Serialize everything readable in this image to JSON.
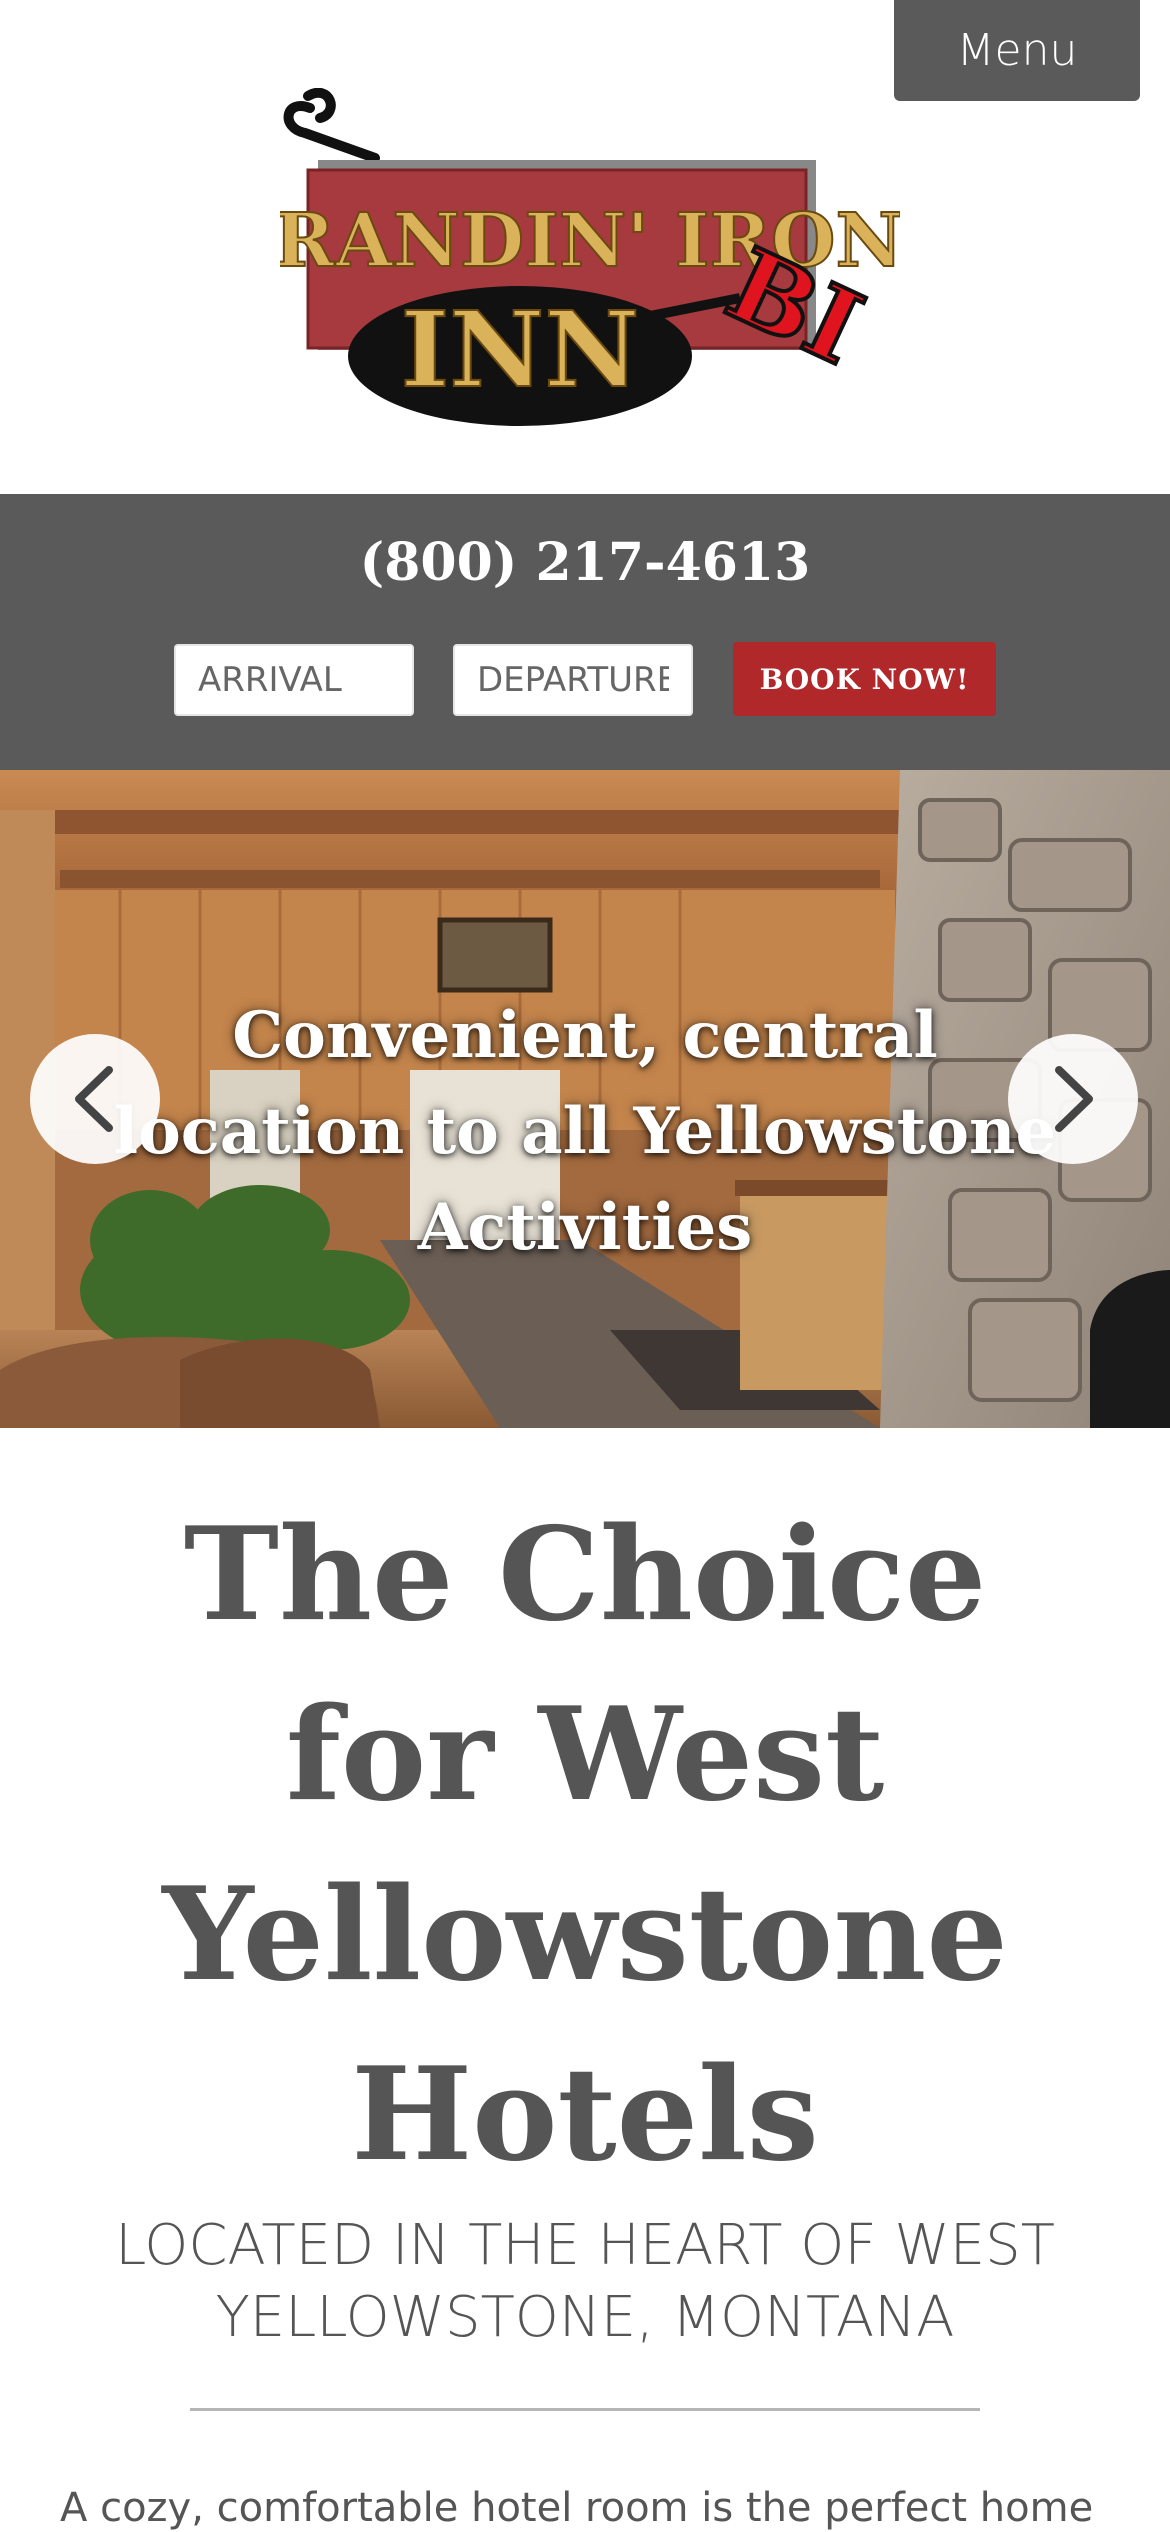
{
  "header": {
    "menu_label": "Menu",
    "logo": {
      "line1": "BRANDIN' IRON",
      "line2": "INN",
      "brand_mark": "BI",
      "colors": {
        "sign": "#a63a3e",
        "text": "#d9b25a",
        "oval": "#111111",
        "brand": "#e0141e"
      }
    }
  },
  "booking": {
    "phone": "(800) 217-4613",
    "arrival_placeholder": "ARRIVAL",
    "departure_placeholder": "DEPARTURE",
    "book_label": "BOOK NOW!",
    "colors": {
      "bar": "#5a5a5a",
      "button": "#b0282a"
    }
  },
  "hero": {
    "caption": "Convenient, central location to all Yellowstone Activities",
    "prev_icon": "chevron-left-icon",
    "next_icon": "chevron-right-icon"
  },
  "content": {
    "title": "The Choice for West Yellowstone Hotels",
    "subtitle": "LOCATED IN THE HEART OF WEST YELLOWSTONE, MONTANA",
    "intro": "A cozy, comfortable hotel room is the perfect home"
  }
}
